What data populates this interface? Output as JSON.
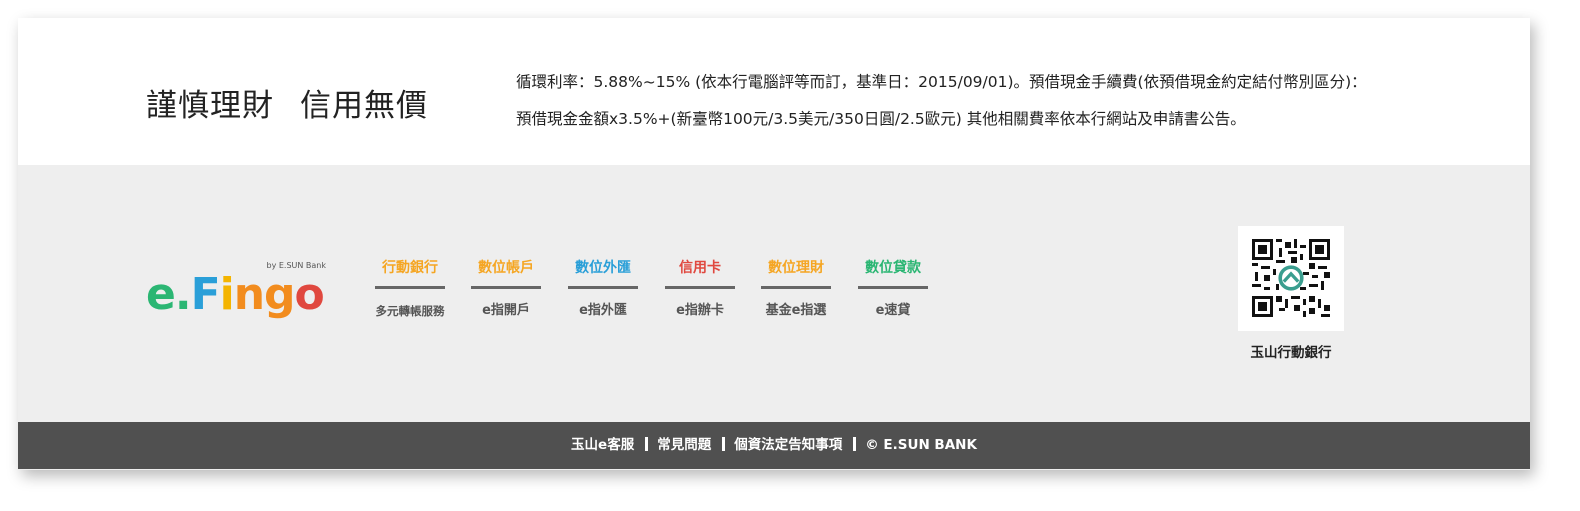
{
  "disclaimer": {
    "slogan_left": "謹慎理財",
    "slogan_right": "信用無價",
    "line1": "循環利率：5.88%~15% (依本行電腦評等而訂，基準日：2015/09/01)。預借現金手續費(依預借現金約定結付幣別區分)：",
    "line2": "預借現金金額x3.5%+(新臺幣100元/3.5美元/350日圓/2.5歐元) 其他相關費率依本行網站及申請書公告。"
  },
  "logo": {
    "byline": "by E.SUN Bank",
    "e": "e",
    "dot": ".",
    "F": "F",
    "i": "i",
    "n": "n",
    "g": "g",
    "o": "o",
    "colors": {
      "e": "#2bb673",
      "dot": "#2bb673",
      "F": "#2a9fd8",
      "i": "#f4b400",
      "n": "#f28c1e",
      "g": "#f28c1e",
      "o": "#e0483f"
    }
  },
  "products": [
    {
      "title": "行動銀行",
      "sub": "多元轉帳服務",
      "color": "#f5a623"
    },
    {
      "title": "數位帳戶",
      "sub": "e指開戶",
      "color": "#f5a623"
    },
    {
      "title": "數位外匯",
      "sub": "e指外匯",
      "color": "#2a9fd8"
    },
    {
      "title": "信用卡",
      "sub": "e指辦卡",
      "color": "#e0483f"
    },
    {
      "title": "數位理財",
      "sub": "基金e指選",
      "color": "#f5a623"
    },
    {
      "title": "數位貸款",
      "sub": "e速貸",
      "color": "#2bb673"
    }
  ],
  "qr": {
    "caption": "玉山行動銀行",
    "icon": "qr-code-icon"
  },
  "footer": {
    "links": [
      "玉山e客服",
      "常見問題",
      "個資法定告知事項",
      "© E.SUN BANK"
    ]
  }
}
